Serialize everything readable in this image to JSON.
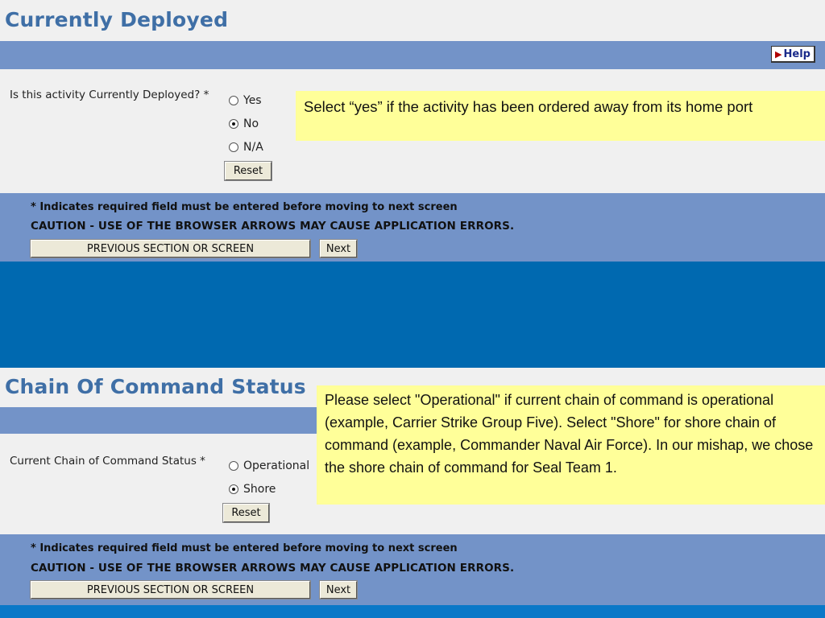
{
  "section1": {
    "title": "Currently Deployed",
    "help_label": "Help",
    "question": "Is this activity Currently Deployed? *",
    "options": [
      "Yes",
      "No",
      "N/A"
    ],
    "selected": "No",
    "reset_label": "Reset",
    "required_note": "* Indicates required field must be entered before moving to next screen",
    "caution": "CAUTION - USE OF THE BROWSER ARROWS MAY CAUSE APPLICATION ERRORS.",
    "prev_label": "PREVIOUS SECTION OR SCREEN",
    "next_label": "Next",
    "callout": "Select “yes” if the activity has been ordered away from its home port"
  },
  "section2": {
    "title": "Chain Of Command Status",
    "question": "Current Chain of Command Status *",
    "options": [
      "Operational",
      "Shore"
    ],
    "selected": "Shore",
    "reset_label": "Reset",
    "required_note": "* Indicates required field must be entered before moving to next screen",
    "caution": "CAUTION - USE OF THE BROWSER ARROWS MAY CAUSE APPLICATION ERRORS.",
    "prev_label": "PREVIOUS SECTION OR SCREEN",
    "next_label": "Next",
    "callout": "Please select \"Operational\" if current chain of command is operational (example, Carrier Strike Group Five).  Select \"Shore\" for shore chain of command (example, Commander Naval Air Force).  In our mishap, we chose the shore chain of command for Seal Team 1."
  },
  "colors": {
    "slide_background": "#0069b0",
    "bar": "#7393c8",
    "title": "#3f6fa6",
    "callout": "#ffff99"
  }
}
